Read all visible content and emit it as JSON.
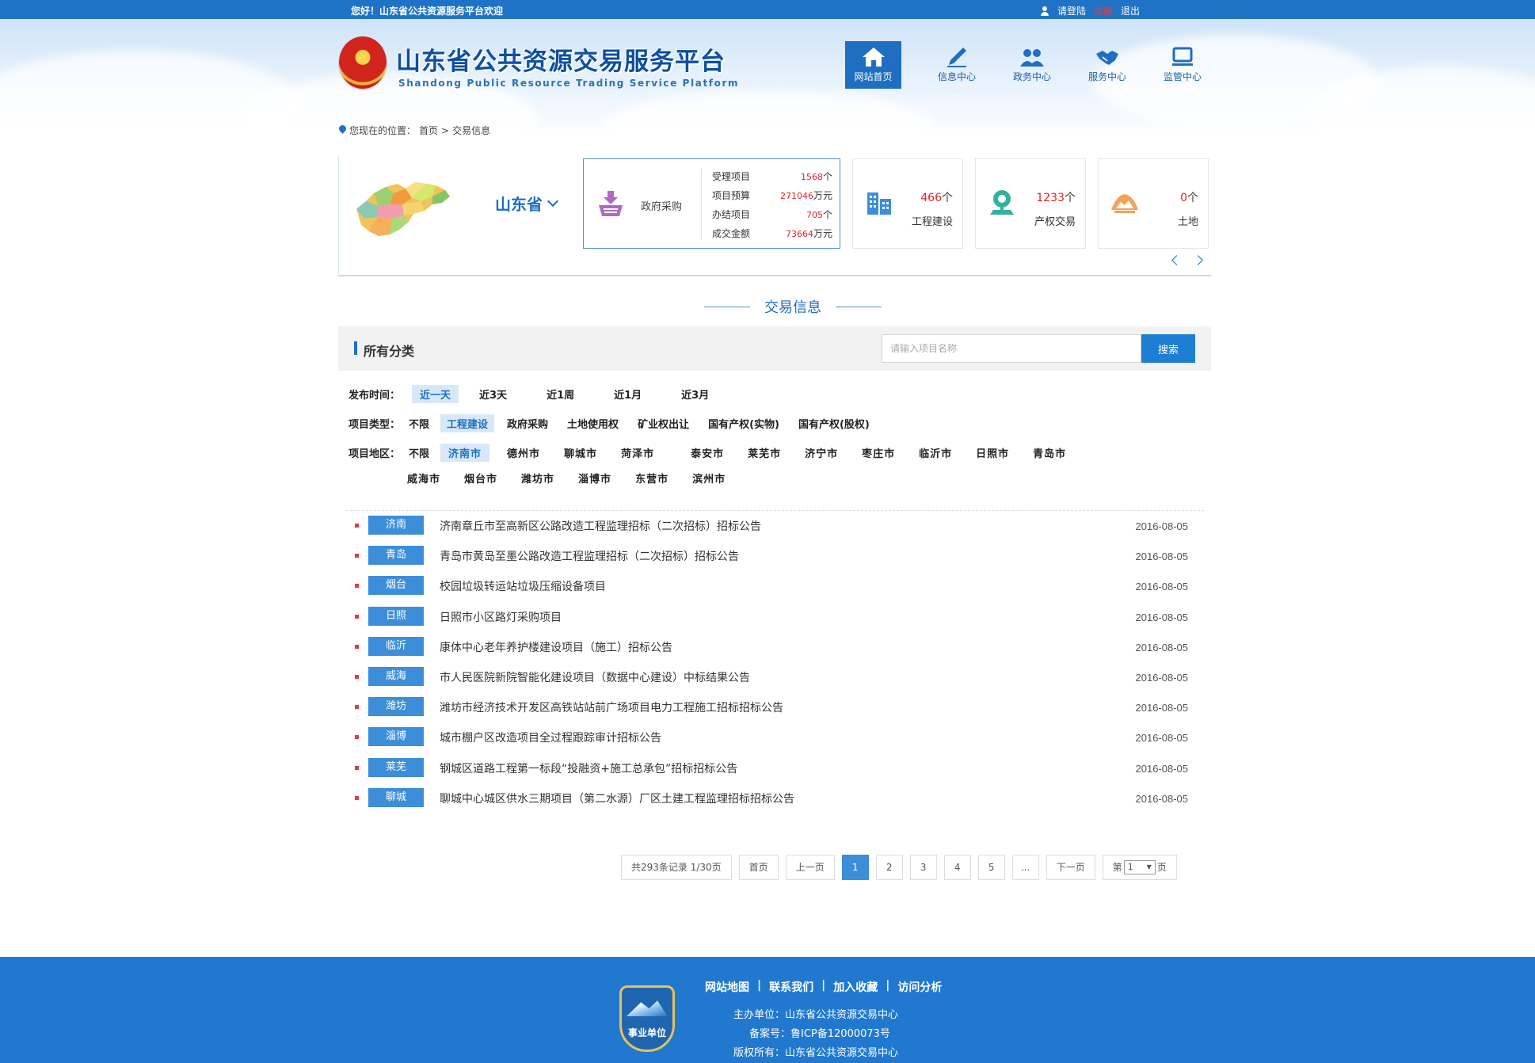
{
  "topbar": {
    "welcome": "您好！山东省公共资源服务平台欢迎",
    "login": "请登陆",
    "favorite": "收藏",
    "logout": "退出"
  },
  "header": {
    "title": "山东省公共资源交易服务平台",
    "subtitle": "Shandong Public Resource Trading Service Platform",
    "nav": [
      {
        "label": "网站首页",
        "icon": "home-icon"
      },
      {
        "label": "信息中心",
        "icon": "pen-icon"
      },
      {
        "label": "政务中心",
        "icon": "people-icon"
      },
      {
        "label": "服务中心",
        "icon": "handshake-icon"
      },
      {
        "label": "监管中心",
        "icon": "monitor-icon"
      }
    ]
  },
  "breadcrumb": {
    "prefix": "您现在的位置：",
    "home": "首页",
    "sep": ">",
    "current": "交易信息"
  },
  "stats": {
    "province": "山东省",
    "main_card": {
      "name": "政府采购",
      "icon": "basket-icon",
      "rows": [
        {
          "label": "受理项目",
          "value": "1568",
          "unit": "个"
        },
        {
          "label": "项目预算",
          "value": "271046",
          "unit": "万元"
        },
        {
          "label": "办结项目",
          "value": "705",
          "unit": "个"
        },
        {
          "label": "成交金额",
          "value": "73664",
          "unit": "万元"
        }
      ]
    },
    "cards": [
      {
        "name": "工程建设",
        "value": "466",
        "unit": "个",
        "icon": "building-icon"
      },
      {
        "name": "产权交易",
        "value": "1233",
        "unit": "个",
        "icon": "property-icon"
      },
      {
        "name": "土地",
        "value": "0",
        "unit": "个",
        "icon": "land-icon"
      }
    ]
  },
  "section_title": "交易信息",
  "filter": {
    "title": "所有分类",
    "search_placeholder": "请输入项目名称",
    "search_button": "搜索",
    "time": {
      "label": "发布时间：",
      "options": [
        "近一天",
        "近3天",
        "近1周",
        "近1月",
        "近3月"
      ],
      "selected": "近一天"
    },
    "type": {
      "label": "项目类型：",
      "options": [
        "不限",
        "工程建设",
        "政府采购",
        "土地使用权",
        "矿业权出让",
        "国有产权(实物)",
        "国有产权(股权)"
      ],
      "selected": "工程建设"
    },
    "region": {
      "label": "项目地区：",
      "options_row1": [
        "不限",
        "济南市",
        "德州市",
        "聊城市",
        "菏泽市",
        "泰安市",
        "莱芜市",
        "济宁市",
        "枣庄市",
        "临沂市",
        "日照市",
        "青岛市"
      ],
      "options_row2": [
        "威海市",
        "烟台市",
        "潍坊市",
        "淄博市",
        "东营市",
        "滨州市"
      ],
      "selected": "济南市"
    }
  },
  "list": [
    {
      "city": "济南",
      "title": "济南章丘市至高新区公路改造工程监理招标（二次招标）招标公告",
      "date": "2016-08-05"
    },
    {
      "city": "青岛",
      "title": "青岛市黄岛至墨公路改造工程监理招标（二次招标）招标公告",
      "date": "2016-08-05"
    },
    {
      "city": "烟台",
      "title": "校园垃圾转运站垃圾压缩设备项目",
      "date": "2016-08-05"
    },
    {
      "city": "日照",
      "title": "日照市小区路灯采购项目",
      "date": "2016-08-05"
    },
    {
      "city": "临沂",
      "title": "康体中心老年养护楼建设项目（施工）招标公告",
      "date": "2016-08-05"
    },
    {
      "city": "威海",
      "title": "市人民医院新院智能化建设项目（数据中心建设）中标结果公告",
      "date": "2016-08-05"
    },
    {
      "city": "潍坊",
      "title": "潍坊市经济技术开发区高铁站站前广场项目电力工程施工招标招标公告",
      "date": "2016-08-05"
    },
    {
      "city": "淄博",
      "title": "城市棚户区改造项目全过程跟踪审计招标公告",
      "date": "2016-08-05"
    },
    {
      "city": "莱芜",
      "title": "钢城区道路工程第一标段“投融资+施工总承包”招标招标公告",
      "date": "2016-08-05"
    },
    {
      "city": "聊城",
      "title": "聊城中心城区供水三期项目（第二水源）厂区土建工程监理招标招标公告",
      "date": "2016-08-05"
    }
  ],
  "pager": {
    "summary": "共293条记录 1/30页",
    "first": "首页",
    "prev": "上一页",
    "pages": [
      "1",
      "2",
      "3",
      "4",
      "5",
      "..."
    ],
    "current": "1",
    "next": "下一页",
    "jump_prefix": "第",
    "jump_value": "1",
    "jump_suffix": "页"
  },
  "footer": {
    "badge": "事业单位",
    "links": [
      "网站地图",
      "联系我们",
      "加入收藏",
      "访问分析"
    ],
    "sep": "|",
    "sponsor": "主办单位：山东省公共资源交易中心",
    "icp": "备案号：鲁ICP备12000073号",
    "copyright": "版权所有：山东省公共资源交易中心"
  },
  "colors": {
    "brand": "#1f73c6",
    "accent_red": "#e02424",
    "tag_blue": "#3c8ed8",
    "footer": "#2079cf"
  }
}
